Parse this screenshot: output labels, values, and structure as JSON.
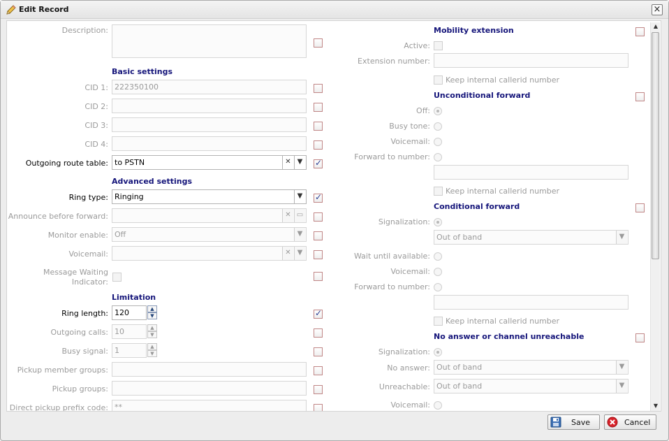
{
  "window": {
    "title": "Edit Record",
    "close_label": "×"
  },
  "left": {
    "description_label": "Description:",
    "basic_title": "Basic settings",
    "cid1_label": "CID 1:",
    "cid1_value": "222350100",
    "cid2_label": "CID 2:",
    "cid2_value": "",
    "cid3_label": "CID 3:",
    "cid3_value": "",
    "cid4_label": "CID 4:",
    "cid4_value": "",
    "route_label": "Outgoing route table:",
    "route_value": "to PSTN",
    "advanced_title": "Advanced settings",
    "ring_type_label": "Ring type:",
    "ring_type_value": "Ringing",
    "announce_label": "Announce before forward:",
    "announce_value": "",
    "monitor_label": "Monitor enable:",
    "monitor_value": "Off",
    "voicemail_label": "Voicemail:",
    "voicemail_value": "",
    "mwi_label_1": "Message Waiting",
    "mwi_label_2": "Indicator:",
    "limitation_title": "Limitation",
    "ring_length_label": "Ring length:",
    "ring_length_value": "120",
    "outgoing_calls_label": "Outgoing calls:",
    "outgoing_calls_value": "10",
    "busy_signal_label": "Busy signal:",
    "busy_signal_value": "1",
    "pickup_member_label": "Pickup member groups:",
    "pickup_member_value": "",
    "pickup_groups_label": "Pickup groups:",
    "pickup_groups_value": "",
    "direct_pickup_label": "Direct pickup prefix code:",
    "direct_pickup_value": "**"
  },
  "right": {
    "mobility_title": "Mobility extension",
    "active_label": "Active:",
    "ext_number_label": "Extension number:",
    "ext_number_value": "",
    "keep_callerid_1": "Keep internal callerid number",
    "uncond_title": "Unconditional forward",
    "off_label": "Off:",
    "busy_tone_label": "Busy tone:",
    "voicemail_label": "Voicemail:",
    "forward_to_label": "Forward to number:",
    "forward_to_value": "",
    "keep_callerid_2": "Keep internal callerid number",
    "cond_title": "Conditional forward",
    "signalization_label": "Signalization:",
    "signalization_value": "Out of band",
    "wait_label": "Wait until available:",
    "cond_voicemail_label": "Voicemail:",
    "cond_forward_label": "Forward to number:",
    "cond_forward_value": "",
    "keep_callerid_3": "Keep internal callerid number",
    "noanswer_title": "No answer or channel unreachable",
    "na_signalization_label": "Signalization:",
    "no_answer_label": "No answer:",
    "no_answer_value": "Out of band",
    "unreachable_label": "Unreachable:",
    "unreachable_value": "Out of band",
    "na_voicemail_label": "Voicemail:"
  },
  "footer": {
    "save_label": "Save",
    "cancel_label": "Cancel"
  },
  "icons": {
    "title": "pencil-icon",
    "save": "floppy-disk-icon",
    "cancel": "cancel-circle-icon"
  },
  "colors": {
    "section_title": "#15157a",
    "check_mark": "#2c3f92",
    "cancel_red": "#d8222a"
  }
}
